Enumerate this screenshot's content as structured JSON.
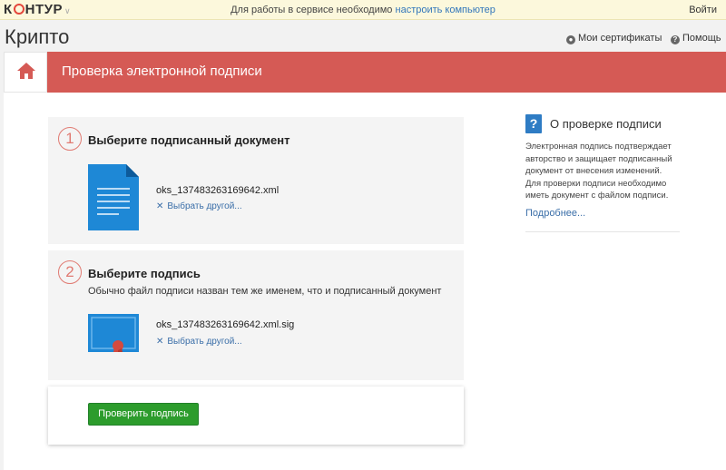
{
  "topbar": {
    "logo_left": "К",
    "logo_right": "НТУР",
    "message": "Для работы в сервисе необходимо",
    "message_link": "настроить компьютер",
    "login": "Войти"
  },
  "header": {
    "title": "Крипто",
    "certificates": "Мои сертификаты",
    "help": "Помощь"
  },
  "banner": {
    "title": "Проверка электронной подписи"
  },
  "steps": [
    {
      "number": "1",
      "title": "Выберите подписанный документ",
      "hint": "",
      "file_name": "oks_137483263169642.xml",
      "choose_other": "Выбрать другой..."
    },
    {
      "number": "2",
      "title": "Выберите подпись",
      "hint": "Обычно файл подписи назван тем же именем, что и подписанный документ",
      "file_name": "oks_137483263169642.xml.sig",
      "choose_other": "Выбрать другой..."
    }
  ],
  "verify": {
    "button_label": "Проверить подпись"
  },
  "side": {
    "title": "О проверке подписи",
    "text": "Электронная подпись подтверждает авторство и защищает подписанный документ от внесения изменений. Для проверки подписи необходимо иметь документ с файлом подписи.",
    "more": "Подробнее..."
  },
  "colors": {
    "banner": "#d55a55",
    "accent_blue": "#2e7cc4",
    "button_green": "#2c9c2c",
    "topbar_bg": "#fcf8dc"
  }
}
